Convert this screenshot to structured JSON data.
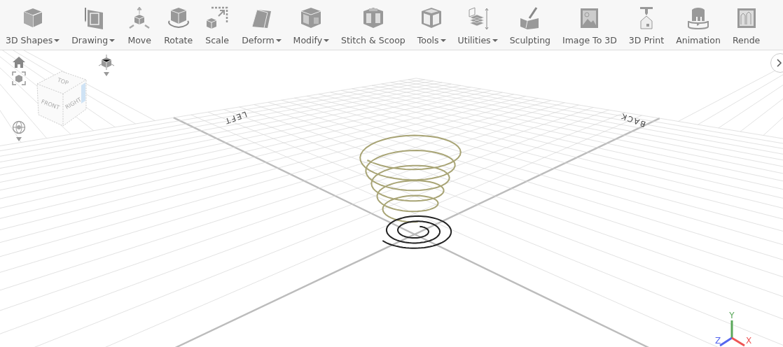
{
  "toolbar": {
    "items": [
      {
        "label": "3D Shapes",
        "dropdown": true
      },
      {
        "label": "Drawing",
        "dropdown": true
      },
      {
        "label": "Move",
        "dropdown": false
      },
      {
        "label": "Rotate",
        "dropdown": false
      },
      {
        "label": "Scale",
        "dropdown": false
      },
      {
        "label": "Deform",
        "dropdown": true
      },
      {
        "label": "Modify",
        "dropdown": true
      },
      {
        "label": "Stitch & Scoop",
        "dropdown": false
      },
      {
        "label": "Tools",
        "dropdown": true
      },
      {
        "label": "Utilities",
        "dropdown": true
      },
      {
        "label": "Sculpting",
        "dropdown": false
      },
      {
        "label": "Image To 3D",
        "dropdown": false
      },
      {
        "label": "3D Print",
        "dropdown": false
      },
      {
        "label": "Animation",
        "dropdown": false
      },
      {
        "label": "Rende",
        "dropdown": false
      }
    ]
  },
  "view_cube": {
    "faces": [
      "TOP",
      "FRONT",
      "RIGHT"
    ]
  },
  "viewport": {
    "direction_labels": [
      "LEFT",
      "BACK"
    ]
  },
  "axes": {
    "x": "X",
    "y": "Y",
    "z": "Z"
  }
}
